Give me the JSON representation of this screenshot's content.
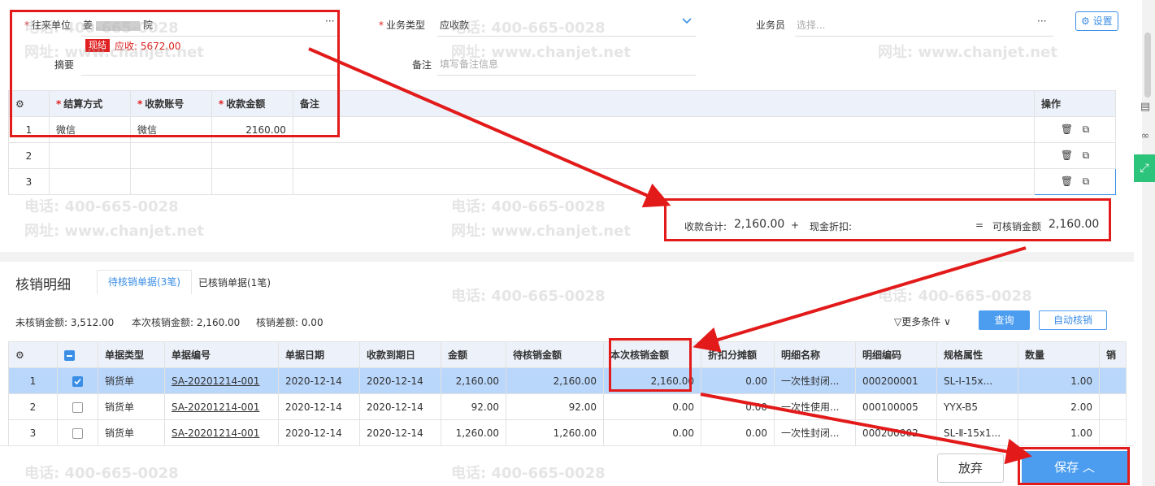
{
  "header": {
    "partner_label": "往来单位",
    "partner_value_a": "姜",
    "partner_value_b": "院",
    "partner_more": "···",
    "badge_label": "现结",
    "receivable_text": "应收: 5672.00",
    "biz_type_label": "业务类型",
    "biz_type_value": "应收款",
    "salesman_label": "业务员",
    "salesman_placeholder": "选择...",
    "salesman_more": "···",
    "setting_label": "设置",
    "summary_label": "摘要",
    "remark_label": "备注",
    "remark_placeholder": "填写备注信息"
  },
  "payment_table": {
    "columns": [
      "结算方式",
      "收款账号",
      "收款金额",
      "备注",
      "操作"
    ],
    "rows": [
      {
        "no": "1",
        "method": "微信",
        "account": "微信",
        "amount": "2160.00",
        "remark": ""
      },
      {
        "no": "2",
        "method": "",
        "account": "",
        "amount": "",
        "remark": ""
      },
      {
        "no": "3",
        "method": "",
        "account": "",
        "amount": "",
        "remark": ""
      }
    ]
  },
  "totals": {
    "receipt_total_label": "收款合计:",
    "receipt_total_value": "2,160.00",
    "plus": "+",
    "cash_discount_label": "现金折扣:",
    "equals": "=",
    "writeoff_available_label": "可核销金额",
    "writeoff_available_value": "2,160.00"
  },
  "writeoff": {
    "title": "核销明细",
    "tab_pending": "待核销单据(3笔)",
    "tab_done": "已核销单据(1笔)",
    "unwritten_label": "未核销金额: 3,512.00",
    "current_label": "本次核销金额: 2,160.00",
    "diff_label": "核销差额: 0.00",
    "more_conditions": "更多条件",
    "query_button": "查询",
    "auto_button": "自动核销",
    "columns": [
      "单据类型",
      "单据编号",
      "单据日期",
      "收款到期日",
      "金额",
      "待核销金额",
      "本次核销金额",
      "折扣分摊额",
      "明细名称",
      "明细编码",
      "规格属性",
      "数量",
      "销"
    ],
    "rows": [
      {
        "no": "1",
        "checked": true,
        "type": "销货单",
        "code": "SA-20201214-001",
        "date": "2020-12-14",
        "due": "2020-12-14",
        "amount": "2,160.00",
        "pending": "2,160.00",
        "current": "2,160.00",
        "discount": "0.00",
        "item_name": "一次性封闭...",
        "item_code": "000200001",
        "spec": "SL-Ⅰ-15x...",
        "qty": "1.00"
      },
      {
        "no": "2",
        "checked": false,
        "type": "销货单",
        "code": "SA-20201214-001",
        "date": "2020-12-14",
        "due": "2020-12-14",
        "amount": "92.00",
        "pending": "92.00",
        "current": "0.00",
        "discount": "0.00",
        "item_name": "一次性使用...",
        "item_code": "000100005",
        "spec": "YYX-B5",
        "qty": "2.00"
      },
      {
        "no": "3",
        "checked": false,
        "type": "销货单",
        "code": "SA-20201214-001",
        "date": "2020-12-14",
        "due": "2020-12-14",
        "amount": "1,260.00",
        "pending": "1,260.00",
        "current": "0.00",
        "discount": "0.00",
        "item_name": "一次性封闭...",
        "item_code": "000200002",
        "spec": "SL-Ⅱ-15x1...",
        "qty": "1.00"
      }
    ]
  },
  "footer": {
    "discard_button": "放弃",
    "save_button": "保存"
  },
  "watermark": {
    "phone": "电话: 400-665-0028",
    "site": "网址: www.chanjet.net"
  },
  "colors": {
    "accent": "#3a8ee6",
    "save_button": "#4c9df0",
    "highlight_box": "#e21a1a",
    "selected_row": "#b9d6fb"
  }
}
